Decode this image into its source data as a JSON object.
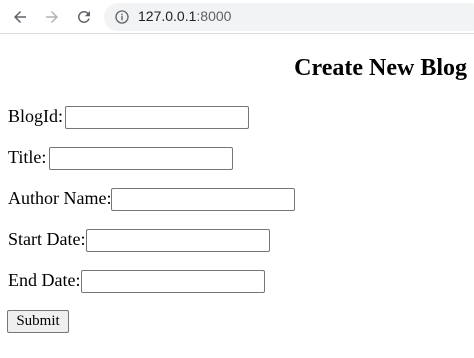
{
  "browser": {
    "url_host": "127.0.0.1",
    "url_port": ":8000"
  },
  "page": {
    "title": "Create New Blog",
    "fields": [
      {
        "label": "BlogId:",
        "value": ""
      },
      {
        "label": "Title:",
        "value": ""
      },
      {
        "label": "Author Name:",
        "value": ""
      },
      {
        "label": "Start Date:",
        "value": ""
      },
      {
        "label": "End Date:",
        "value": ""
      }
    ],
    "submit_label": "Submit"
  }
}
